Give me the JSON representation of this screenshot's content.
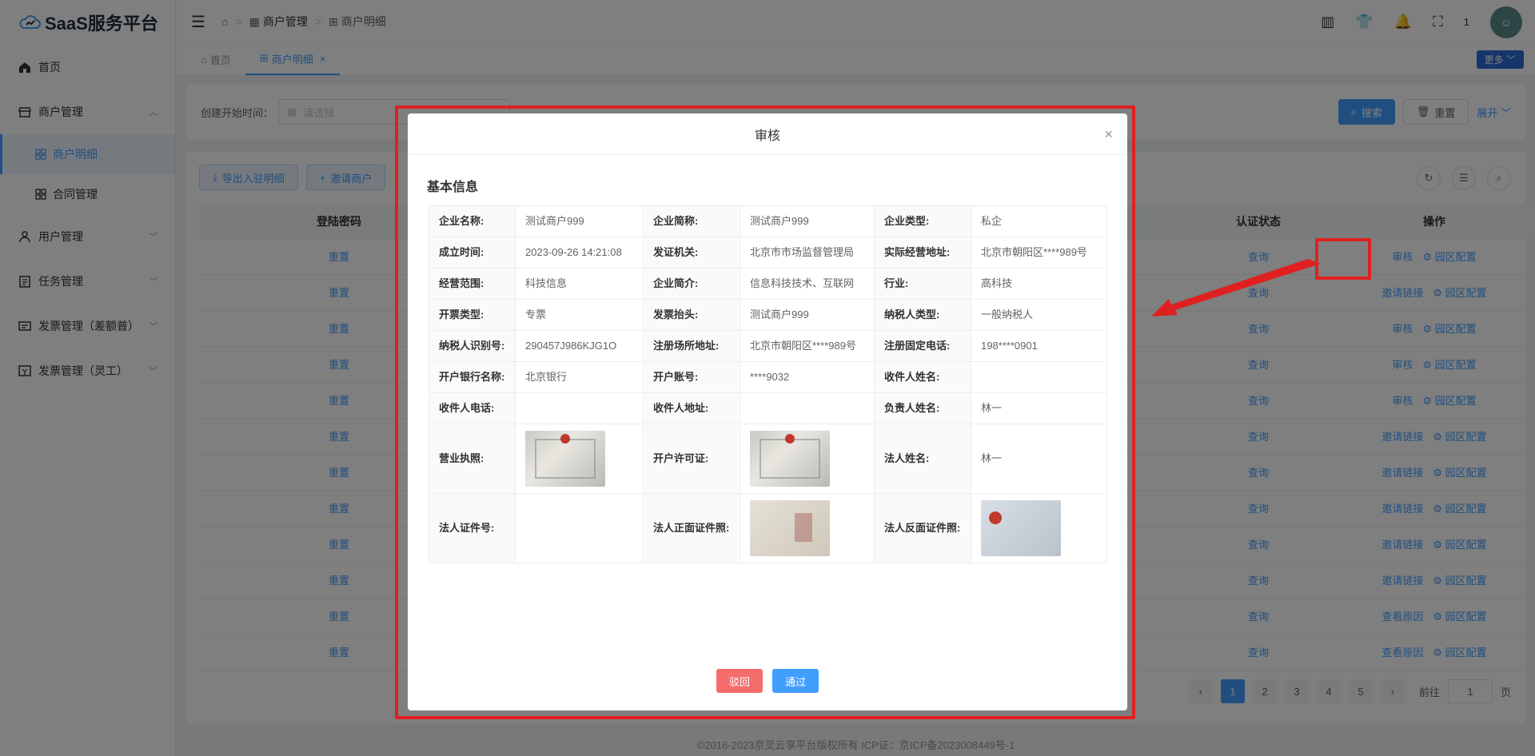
{
  "app": {
    "logo_text": "SaaS服务平台"
  },
  "sidebar": {
    "items": [
      {
        "label": "首页"
      },
      {
        "label": "商户管理"
      },
      {
        "label": "商户明细"
      },
      {
        "label": "合同管理"
      },
      {
        "label": "用户管理"
      },
      {
        "label": "任务管理"
      },
      {
        "label": "发票管理（差额普）"
      },
      {
        "label": "发票管理（灵工）"
      }
    ]
  },
  "header": {
    "breadcrumb": [
      "商户管理",
      "商户明细"
    ],
    "user_count": "1"
  },
  "tabs": [
    {
      "label": "首页"
    },
    {
      "label": "商户明细"
    }
  ],
  "more_label": "更多",
  "filter": {
    "start_label": "创建开始时间：",
    "placeholder": "请选择",
    "search_label": "搜索",
    "reset_label": "重置",
    "expand_label": "展开"
  },
  "toolbar": {
    "export_label": "导出入驻明细",
    "invite_label": "邀请商户"
  },
  "table": {
    "headers": {
      "login_pwd": "登陆密码",
      "auth_status": "认证状态",
      "ops": "操作"
    },
    "rows": [
      {
        "pwd": "重置",
        "auth": "查询",
        "op1": "审核",
        "op2": "园区配置"
      },
      {
        "pwd": "重置",
        "auth": "查询",
        "op1": "邀请链接",
        "op2": "园区配置"
      },
      {
        "pwd": "重置",
        "auth": "查询",
        "op1": "审核",
        "op2": "园区配置"
      },
      {
        "pwd": "重置",
        "auth": "查询",
        "op1": "审核",
        "op2": "园区配置"
      },
      {
        "pwd": "重置",
        "auth": "查询",
        "op1": "审核",
        "op2": "园区配置"
      },
      {
        "pwd": "重置",
        "auth": "查询",
        "op1": "邀请链接",
        "op2": "园区配置"
      },
      {
        "pwd": "重置",
        "auth": "查询",
        "op1": "邀请链接",
        "op2": "园区配置"
      },
      {
        "pwd": "重置",
        "auth": "查询",
        "op1": "邀请链接",
        "op2": "园区配置"
      },
      {
        "pwd": "重置",
        "auth": "查询",
        "op1": "邀请链接",
        "op2": "园区配置"
      },
      {
        "pwd": "重置",
        "auth": "查询",
        "op1": "邀请链接",
        "op2": "园区配置"
      },
      {
        "pwd": "重置",
        "auth": "查询",
        "op1": "查看原因",
        "op2": "园区配置"
      },
      {
        "pwd": "重置",
        "auth": "查询",
        "op1": "查看原因",
        "op2": "园区配置"
      }
    ]
  },
  "pager": {
    "pages": [
      "1",
      "2",
      "3",
      "4",
      "5"
    ],
    "goto_label": "前往",
    "goto_value": "1",
    "page_unit": "页"
  },
  "footer": "©2016-2023京灵云享平台版权所有 ICP证：京ICP备2023008449号-1",
  "dialog": {
    "title": "审核",
    "section_title": "基本信息",
    "rows": [
      [
        "企业名称:",
        "测试商户999",
        "企业简称:",
        "测试商户999",
        "企业类型:",
        "私企"
      ],
      [
        "成立时间:",
        "2023-09-26 14:21:08",
        "发证机关:",
        "北京市市场监督管理局",
        "实际经营地址:",
        "北京市朝阳区****989号"
      ],
      [
        "经营范围:",
        "科技信息",
        "企业简介:",
        "信息科技技术、互联网",
        "行业:",
        "高科技"
      ],
      [
        "开票类型:",
        "专票",
        "发票抬头:",
        "测试商户999",
        "纳税人类型:",
        "一般纳税人"
      ],
      [
        "纳税人识别号:",
        "290457J986KJG1O",
        "注册场所地址:",
        "北京市朝阳区****989号",
        "注册固定电话:",
        "198****0901"
      ],
      [
        "开户银行名称:",
        "北京银行",
        "开户账号:",
        "****9032",
        "收件人姓名:",
        ""
      ],
      [
        "收件人电话:",
        "",
        "收件人地址:",
        "",
        "负责人姓名:",
        "林一"
      ],
      [
        "营业执照:",
        "",
        "开户许可证:",
        "",
        "法人姓名:",
        "林一"
      ],
      [
        "法人证件号:",
        "",
        "法人正面证件照:",
        "",
        "法人反面证件照:",
        ""
      ]
    ],
    "reject_label": "驳回",
    "pass_label": "通过"
  }
}
